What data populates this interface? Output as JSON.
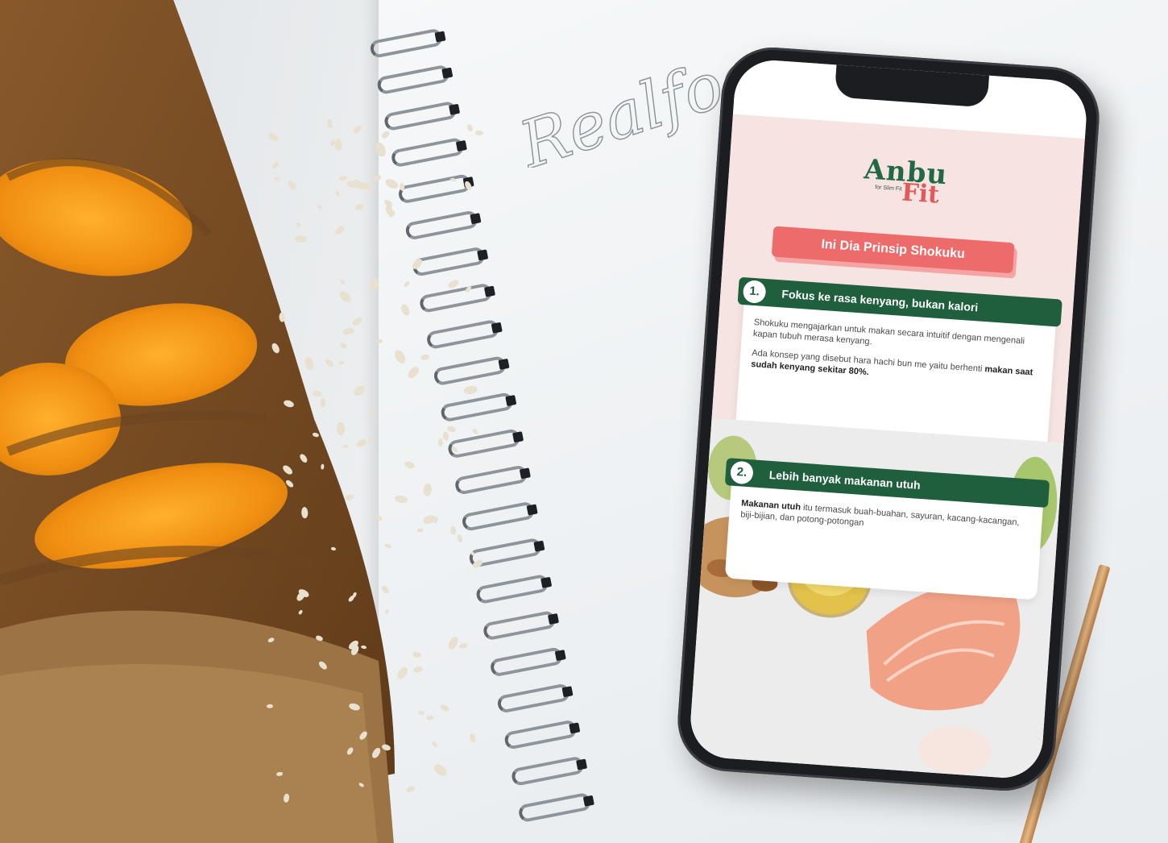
{
  "scene": {
    "handwriting": "Realfood"
  },
  "app": {
    "brand": {
      "top": "Anbu",
      "middle": "for Slim Fit",
      "bottom": "Fit"
    },
    "headline": "Ini Dia Prinsip Shokuku",
    "cards": [
      {
        "number": "1.",
        "title": "Fokus ke rasa kenyang, bukan kalori",
        "para1": "Shokuku mengajarkan untuk makan secara intuitif dengan mengenali kapan tubuh merasa kenyang.",
        "para2_prefix": "Ada konsep yang disebut hara hachi bun me yaitu berhenti ",
        "para2_bold": "makan saat sudah kenyang sekitar 80%."
      },
      {
        "number": "2.",
        "title": "Lebih banyak makanan utuh",
        "para1_bold": "Makanan utuh",
        "para1_rest": " itu termasuk buah-buahan, sayuran, kacang-kacangan, biji-bijian, dan potong-potongan"
      }
    ]
  },
  "colors": {
    "brand_green": "#1f6a45",
    "brand_red": "#e05a5a",
    "headline_bg": "#ee6b6b",
    "card_head_bg": "#1f5f3d"
  }
}
